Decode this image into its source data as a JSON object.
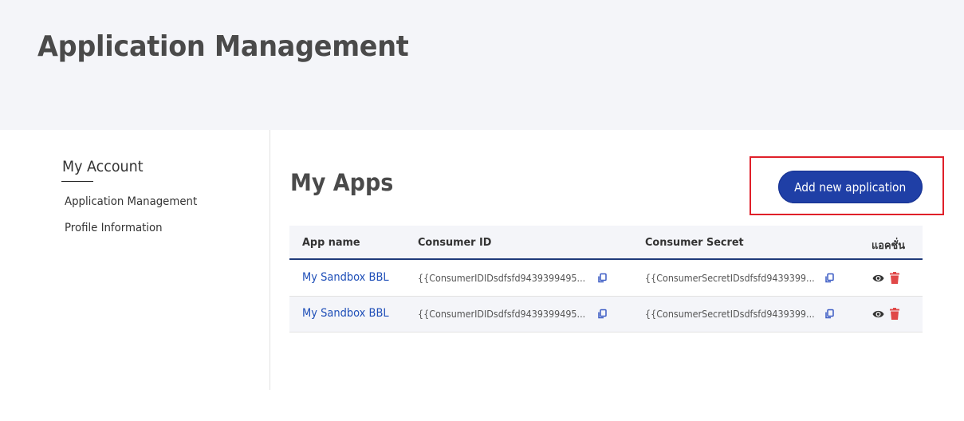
{
  "header": {
    "title": "Application Management"
  },
  "sidebar": {
    "title": "My Account",
    "items": [
      {
        "label": "Application Management"
      },
      {
        "label": "Profile Information"
      }
    ]
  },
  "main": {
    "section_title": "My Apps",
    "add_button_label": "Add new application",
    "table": {
      "columns": [
        "App name",
        "Consumer ID",
        "Consumer Secret",
        "แอคชั่น"
      ],
      "rows": [
        {
          "app_name": "My Sandbox BBL",
          "consumer_id": "{{ConsumerIDIDsdfsfd9439399495...",
          "consumer_secret": "{{ConsumerSecretIDsdfsfd9439399..."
        },
        {
          "app_name": "My Sandbox BBL",
          "consumer_id": "{{ConsumerIDIDsdfsfd9439399495...",
          "consumer_secret": "{{ConsumerSecretIDsdfsfd9439399..."
        }
      ]
    }
  },
  "colors": {
    "primary": "#1f3fa6",
    "link": "#1f4fb8",
    "danger": "#e04848",
    "highlight": "#e0202a",
    "header_bg": "#f4f5f9"
  }
}
